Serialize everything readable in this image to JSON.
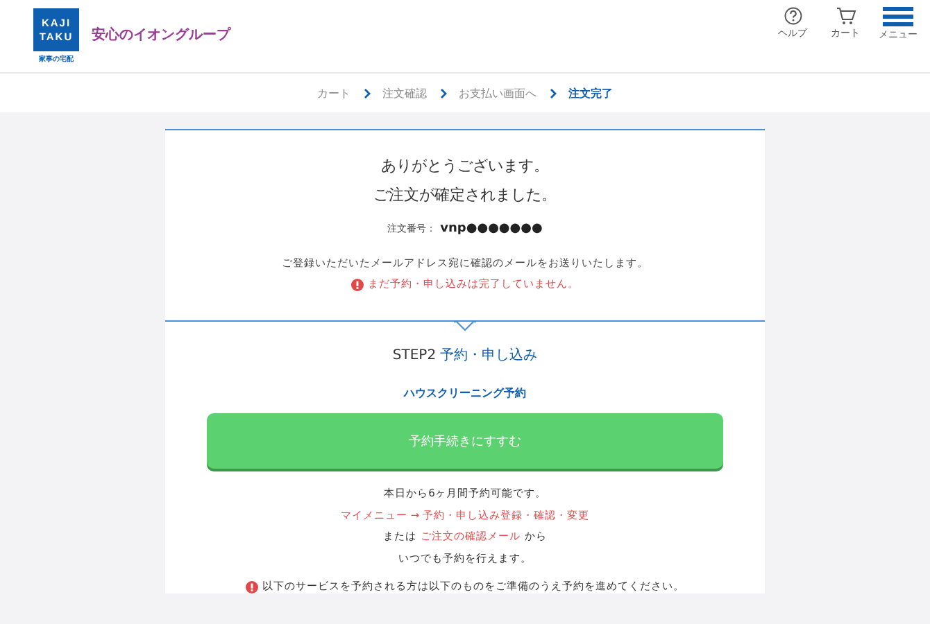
{
  "header": {
    "logo_lines": [
      "KAJI",
      "TAKU"
    ],
    "logo_caption": "家事の宅配",
    "tagline": "安心のイオングループ",
    "actions": [
      {
        "kind": "help",
        "label": "ヘルプ"
      },
      {
        "kind": "cart",
        "label": "カート"
      },
      {
        "kind": "menu",
        "label": "メニュー"
      }
    ]
  },
  "breadcrumb": [
    {
      "label": "カート",
      "selected": false
    },
    {
      "label": "注文確認",
      "selected": false
    },
    {
      "label": "お支払い画面へ",
      "selected": false
    },
    {
      "label": "注文完了",
      "selected": true
    }
  ],
  "confirmation": {
    "heading_lines": [
      "ありがとうございます。",
      "ご注文が確定されました。"
    ],
    "order_label": "注文番号：",
    "order_number": "vnp●●●●●●●",
    "mail_notice": "ご登録いただいたメールアドレス宛に確認のメールをお送りいたします。",
    "warning": "まだ予約・申し込みは完了していません。"
  },
  "step": {
    "number": "STEP2",
    "title": "予約・申し込み",
    "service": "ハウスクリーニング予約",
    "button": "予約手続きにすすむ",
    "info_lines": [
      [
        {
          "kind": "text",
          "text": "本日から6ヶ月間予約可能です。"
        }
      ],
      [
        {
          "kind": "link",
          "text": "マイメニュー → 予約・申し込み登録・確認・変更"
        }
      ],
      [
        {
          "kind": "text",
          "text": "または"
        },
        {
          "kind": "link",
          "text": "ご注文の確認メール"
        },
        {
          "kind": "text",
          "text": "から"
        }
      ],
      [
        {
          "kind": "text",
          "text": "いつでも予約を行えます。"
        }
      ]
    ],
    "notice": "以下のサービスを予約される方は以下のものをご準備のうえ予約を進めてください。"
  }
}
